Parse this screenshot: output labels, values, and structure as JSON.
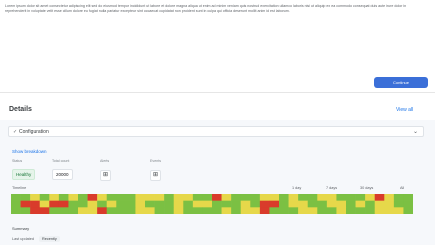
{
  "intro": {
    "text": "Lorem ipsum dolor sit amet consectetur adipiscing elit sed do eiusmod tempor incididunt ut labore et dolore magna aliqua ut enim ad minim veniam quis nostrud exercitation ullamco laboris nisi ut aliquip ex ea commodo consequat duis aute irure dolor in reprehenderit in voluptate velit esse cillum dolore eu fugiat nulla pariatur excepteur sint occaecat cupidatat non proident sunt in culpa qui officia deserunt mollit anim id est laborum."
  },
  "primary_button": {
    "label": "Continue"
  },
  "section": {
    "title": "Details",
    "link": "View all"
  },
  "selector": {
    "label": "Configuration"
  },
  "panel": {
    "link": "Show breakdown",
    "stats": [
      {
        "label": "Status",
        "value": "Healthy",
        "style": "good"
      },
      {
        "label": "Total count",
        "value": "20000",
        "style": "plain"
      },
      {
        "label": "Alerts",
        "value": "",
        "style": "icon"
      },
      {
        "label": "Events",
        "value": "",
        "style": "icon"
      }
    ]
  },
  "timeline": {
    "label": "Timeline",
    "tabs": [
      "1 day",
      "7 days",
      "30 days",
      "All"
    ]
  },
  "footer": {
    "label": "Summary",
    "meta": "Last updated",
    "pill": "Recently"
  },
  "colors": {
    "accent": "#3b6fd8",
    "link": "#1a73e8",
    "good": "#7bc043",
    "warn": "#e6d84a",
    "bad": "#d93b2b"
  },
  "heatmap": {
    "rows": [
      "ggygygygrygggyyygyyggrygggyygyggyygggyrygg",
      "grryrrggygyggygggygyygggygrrgyyggyygygyygg",
      "ggrrgggyyrgggyyggyggggygyyrgggyyggygggyyyg"
    ]
  }
}
